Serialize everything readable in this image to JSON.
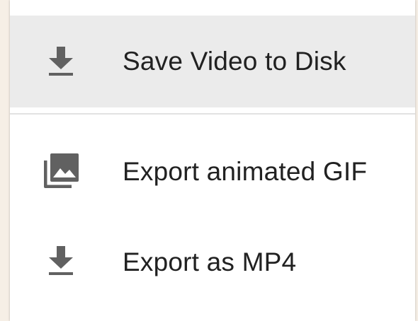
{
  "menu": {
    "items": [
      {
        "label": "Save Video to Disk",
        "icon": "download-icon",
        "highlighted": true
      },
      {
        "label": "Export animated GIF",
        "icon": "photo-library-icon",
        "highlighted": false
      },
      {
        "label": "Export as MP4",
        "icon": "download-icon",
        "highlighted": false
      }
    ]
  },
  "colors": {
    "highlight": "#ebebeb",
    "icon": "#616161",
    "text": "#212121",
    "divider": "#e2e2e2",
    "background": "#f6efe6"
  }
}
